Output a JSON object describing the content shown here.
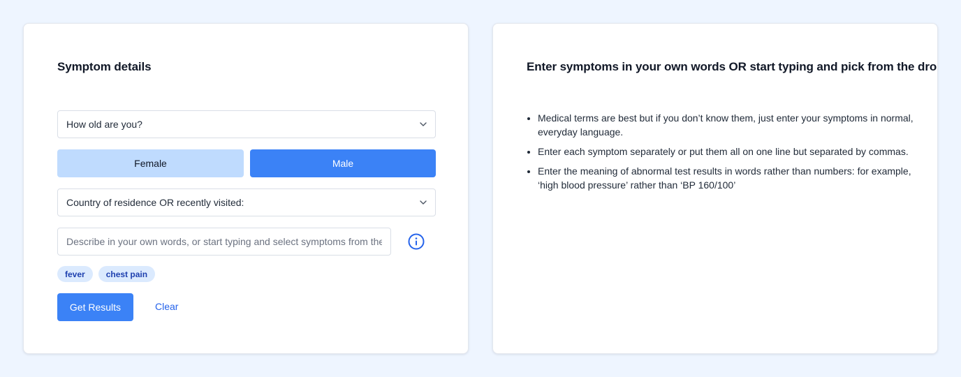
{
  "left_card": {
    "title": "Symptom details",
    "age_select": {
      "label": "How old are you?"
    },
    "sex": {
      "female_label": "Female",
      "male_label": "Male",
      "selected": "Male"
    },
    "country_select": {
      "label": "Country of residence OR recently visited:"
    },
    "symptom_input": {
      "value": "",
      "placeholder": "Describe in your own words, or start typing and select symptoms from the list"
    },
    "info_icon": "info-circle-icon",
    "tags": [
      {
        "label": "fever"
      },
      {
        "label": "chest pain"
      }
    ],
    "get_results_label": "Get Results",
    "clear_label": "Clear"
  },
  "right_card": {
    "title": "Enter symptoms in your own words OR start typing and pick from the drop-down list",
    "tips": [
      "Medical terms are best but if you don’t know them, just enter your symptoms in normal, everyday language.",
      "Enter each symptom separately or put them all on one line but separated by commas.",
      "Enter the meaning of abnormal test results in words rather than numbers: for example, ‘high blood pressure’ rather than ‘BP 160/100’"
    ]
  },
  "colors": {
    "page_background": "#eef5ff",
    "primary": "#3b82f6",
    "primary_light": "#bfdbfe",
    "tag_background": "#dbeafe",
    "link": "#2563eb"
  }
}
